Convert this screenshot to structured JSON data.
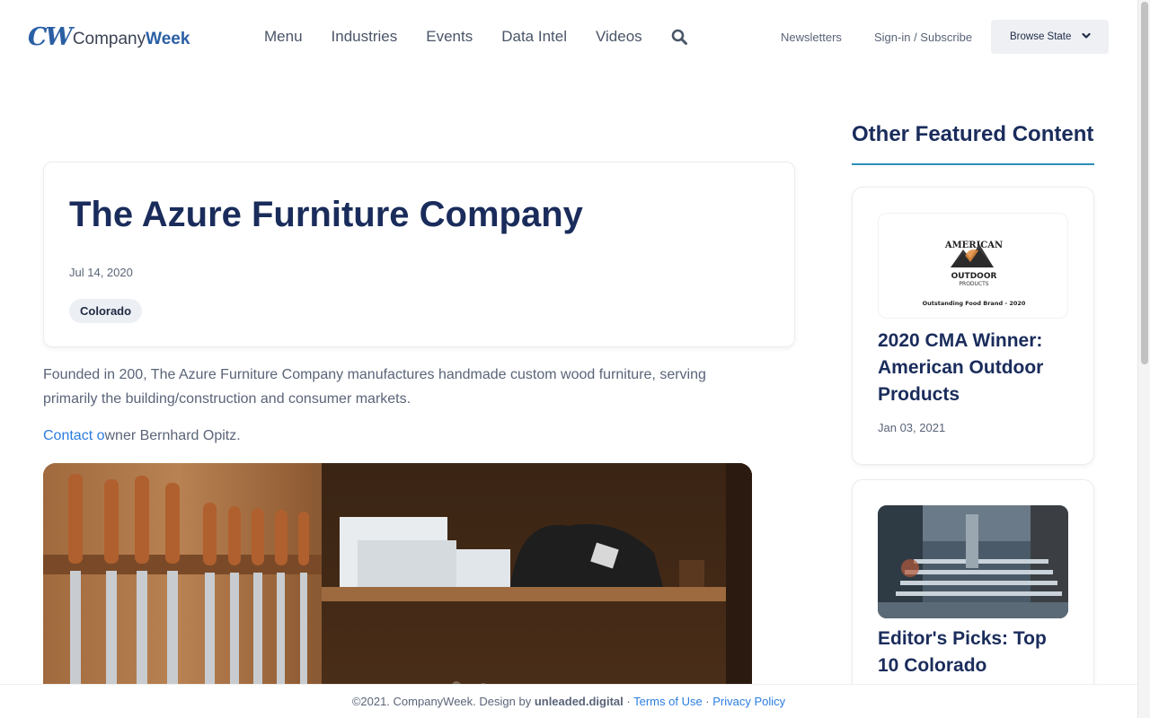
{
  "brand": {
    "mark": "CW",
    "name_prefix": "Company",
    "name_suffix": "Week"
  },
  "nav": {
    "items": [
      "Menu",
      "Industries",
      "Events",
      "Data Intel",
      "Videos"
    ],
    "search_icon": "search-icon"
  },
  "utility": {
    "newsletters": "Newsletters",
    "signin": "Sign-in / Subscribe",
    "browse_state": "Browse State"
  },
  "article": {
    "title": "The Azure Furniture Company",
    "date": "Jul 14, 2020",
    "tag": "Colorado",
    "body": "Founded in 200, The Azure Furniture Company manufactures handmade custom wood furniture, serving primarily the building/construction and consumer markets.",
    "contact_link": "Contact o",
    "contact_rest": "wner Bernhard Opitz."
  },
  "sidebar": {
    "title": "Other Featured Content",
    "cards": [
      {
        "title": "2020 CMA Winner: American Outdoor Products",
        "date": "Jan 03, 2021",
        "image_text_top": "AMERICAN",
        "image_text_mid": "OUTDOOR",
        "image_text_sub": "PRODUCTS",
        "image_caption": "Outstanding Food Brand - 2020"
      },
      {
        "title": "Editor's Picks: Top 10 Colorado"
      }
    ]
  },
  "footer": {
    "copyright": "©2021. CompanyWeek. Design by ",
    "designer": "unleaded.digital",
    "sep": " · ",
    "terms": "Terms of Use",
    "privacy": "Privacy Policy"
  },
  "colors": {
    "accent": "#1a2c5b",
    "link": "#2b7de0",
    "rule": "#2d8fb8"
  }
}
